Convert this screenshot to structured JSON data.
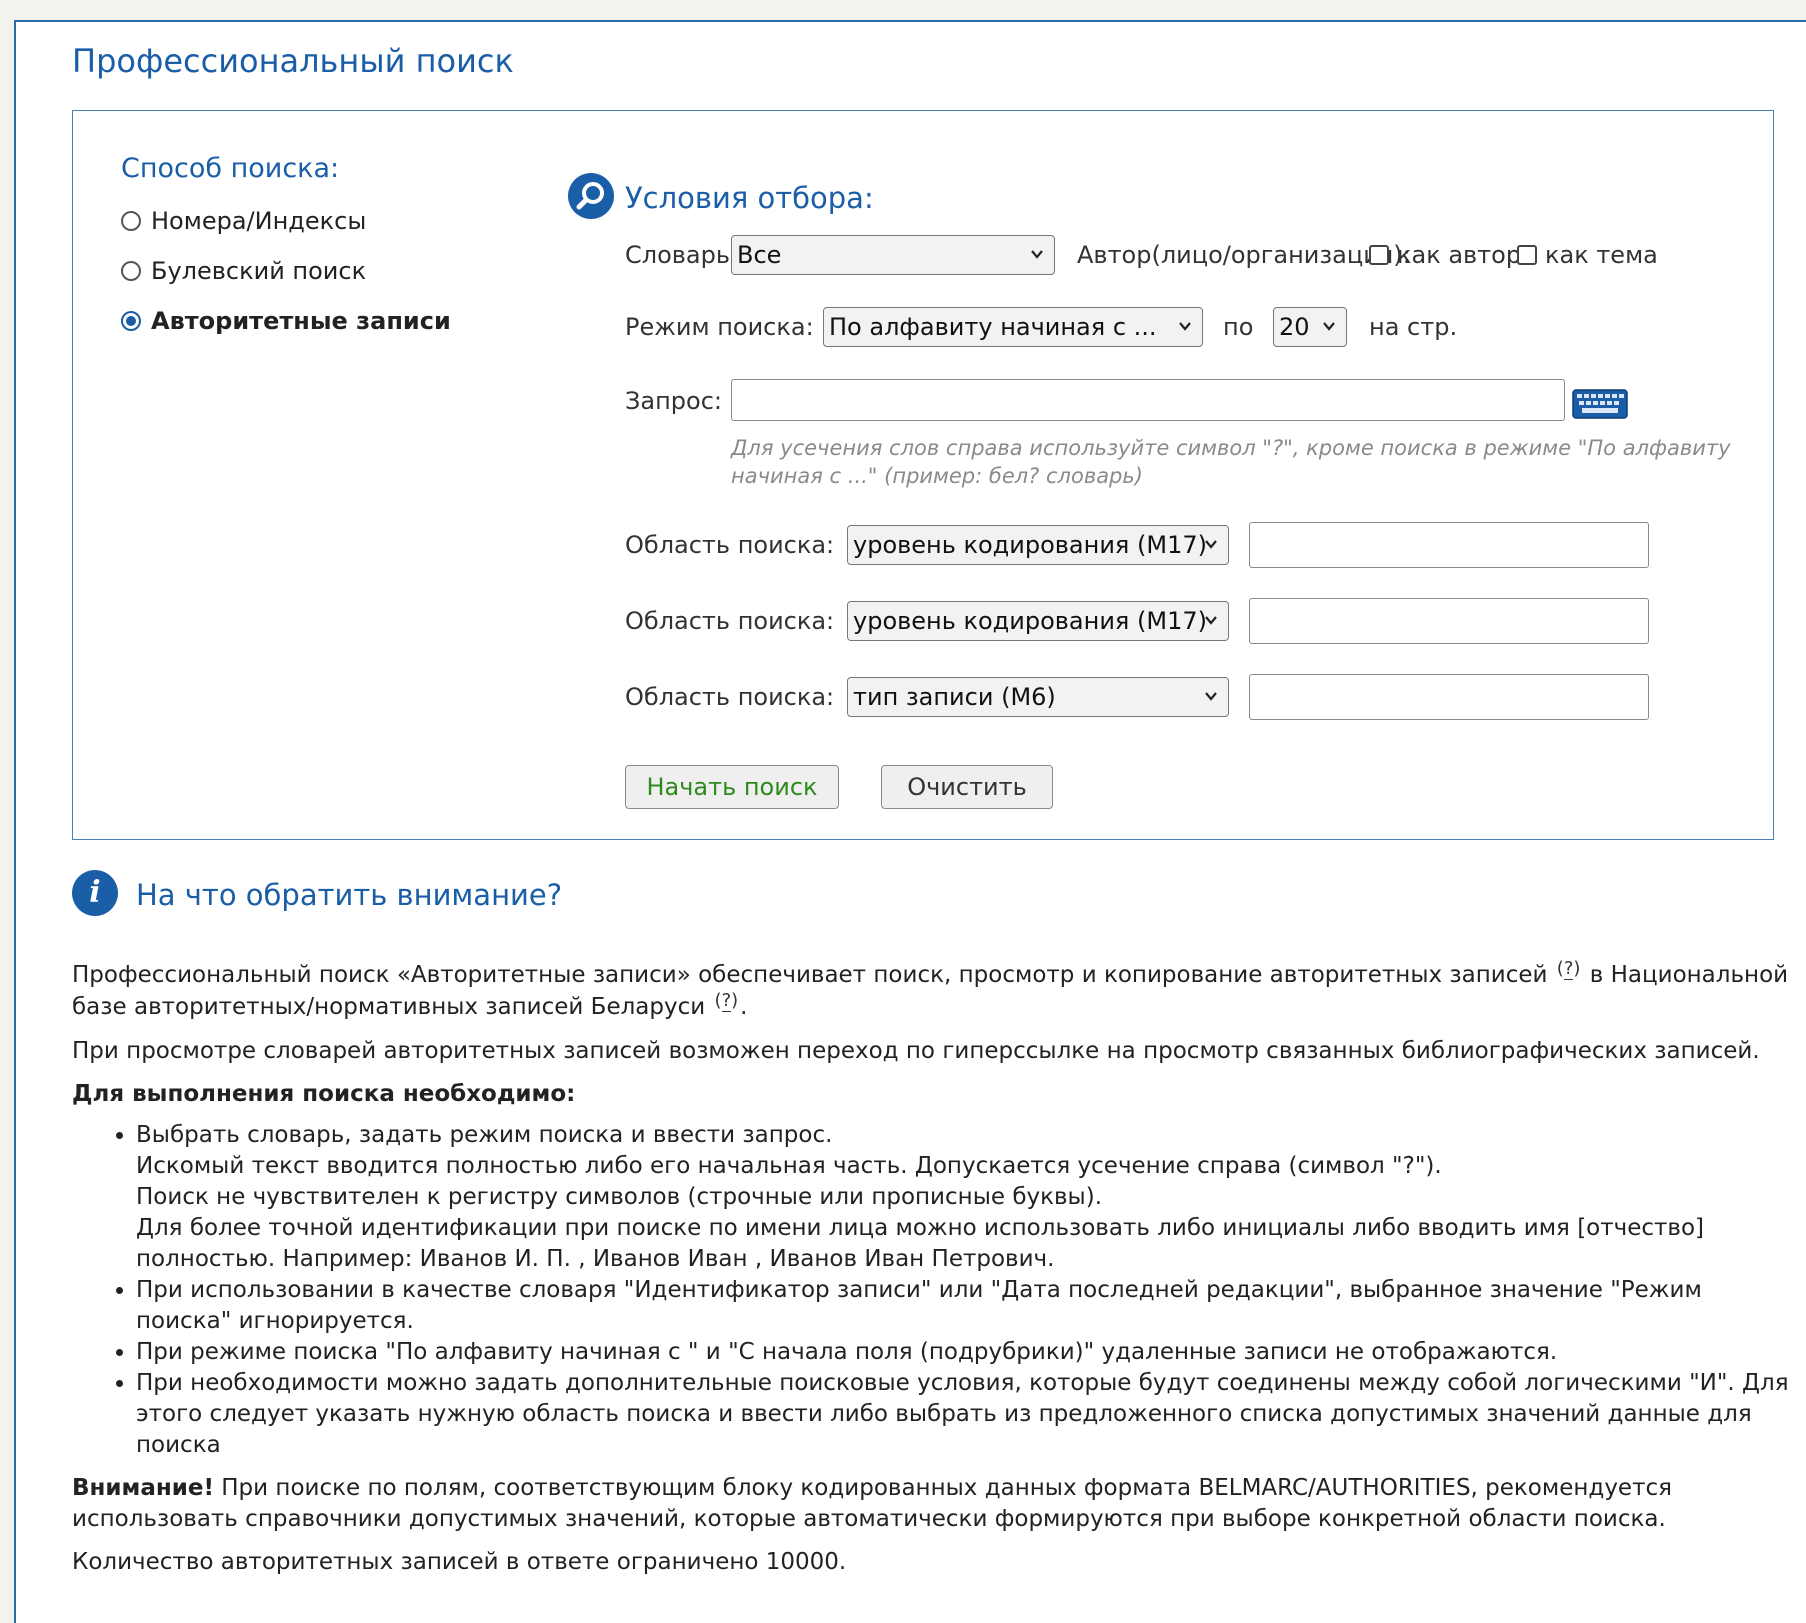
{
  "page_title": "Профессиональный поиск",
  "method": {
    "title": "Способ поиска:",
    "options": [
      {
        "label": "Номера/Индексы",
        "checked": false
      },
      {
        "label": "Булевский поиск",
        "checked": false
      },
      {
        "label": "Авторитетные записи",
        "checked": true
      }
    ]
  },
  "conditions": {
    "title": "Условия отбора:",
    "dictionary_label": "Словарь:",
    "dictionary_value": "Все",
    "author_label": "Автор(лицо/организация):",
    "as_author_label": "как автор",
    "as_subject_label": "как тема",
    "mode_label": "Режим поиска:",
    "mode_value": "По алфавиту начиная с ...",
    "per_label": "по",
    "per_value": "20",
    "per_suffix": "на стр.",
    "query_label": "Запрос:",
    "query_value": "",
    "hint": "Для усечения слов справа используйте символ \"?\", кроме поиска в режиме \"По алфавиту начиная с ...\" (пример: бел? словарь)",
    "area_label": "Область поиска:",
    "areas": [
      {
        "value": "уровень кодирования (М17)",
        "input": ""
      },
      {
        "value": "уровень кодирования (М17)",
        "input": ""
      },
      {
        "value": "тип записи (М6)",
        "input": ""
      }
    ],
    "search_button": "Начать поиск",
    "clear_button": "Очистить"
  },
  "info": {
    "title": "На что обратить внимание?",
    "p1_a": "Профессиональный поиск «Авторитетные записи» обеспечивает поиск, просмотр и копирование авторитетных записей",
    "p1_b": "в Национальной базе авторитетных/нормативных записей Беларуси",
    "p1_c": ".",
    "help_mark": "?",
    "p2": "При просмотре словарей авторитетных записей возможен переход по гиперссылке на просмотр связанных библиографических записей.",
    "lead": "Для выполнения поиска необходимо:",
    "bullet1": [
      "Выбрать словарь, задать режим поиска и ввести запрос.",
      "Искомый текст вводится полностью либо его начальная часть. Допускается усечение справа (символ \"?\").",
      "Поиск не чувствителен к регистру символов (строчные или прописные буквы).",
      "Для более точной идентификации при поиске по имени лица можно использовать либо инициалы либо вводить имя [отчество] полностью. Например: Иванов И. П. , Иванов Иван , Иванов Иван Петрович."
    ],
    "bullet2": "При использовании в качестве словаря \"Идентификатор записи\" или \"Дата последней редакции\", выбранное значение \"Режим поиска\" игнорируется.",
    "bullet3": "При режиме поиска \"По алфавиту начиная с \" и \"С начала поля (подрубрики)\" удаленные записи не отображаются.",
    "bullet4": "При необходимости можно задать дополнительные поисковые условия, которые будут соединены между собой логическими \"И\". Для этого следует указать нужную область поиска и ввести либо выбрать из предложенного списка допустимых значений данные для поиска",
    "warning_bold": "Внимание!",
    "warning_text": " При поиске по полям, соответствующим блоку кодированных данных формата BELMARC/AUTHORITIES, рекомендуется использовать справочники допустимых значений, которые автоматически формируются при выборе конкретной области поиска.",
    "limit": "Количество авторитетных записей в ответе ограничено 10000."
  },
  "colors": {
    "accent": "#1a5ea8",
    "search_button_text": "#2f8a1e",
    "hint_text": "#8a8a8a"
  },
  "icons": [
    "search-icon",
    "keyboard-icon",
    "info-icon",
    "chevron-down-icon",
    "help-icon"
  ]
}
